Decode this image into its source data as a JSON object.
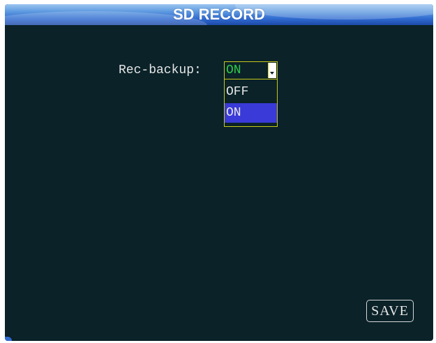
{
  "window": {
    "title": "SD RECORD"
  },
  "form": {
    "rec_backup": {
      "label": "Rec-backup:",
      "selected": "ON",
      "options": [
        "OFF",
        "ON"
      ]
    }
  },
  "footer": {
    "save_label": "SAVE"
  },
  "colors": {
    "background": "#0a2228",
    "title_bar": "#2f6ad0",
    "selected_value": "#2ec94a",
    "field_border": "#c8c818",
    "highlighted_option": "#3a3ad8"
  }
}
